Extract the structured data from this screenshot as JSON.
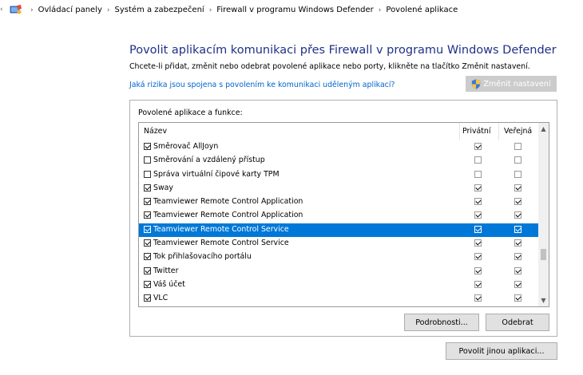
{
  "breadcrumb": {
    "items": [
      "Ovládací panely",
      "Systém a zabezpečení",
      "Firewall v programu Windows Defender",
      "Povolené aplikace"
    ]
  },
  "header": {
    "title": "Povolit aplikacím komunikaci přes Firewall v programu Windows Defender",
    "description": "Chcete-li přidat, změnit nebo odebrat povolené aplikace nebo porty, klikněte na tlačítko Změnit nastavení.",
    "risk_link": "Jaká rizika jsou spojena s povolením ke komunikaci uděleným aplikací?",
    "change_button": "Změnit nastavení"
  },
  "apps": {
    "group_label": "Povolené aplikace a funkce:",
    "columns": {
      "name": "Název",
      "private": "Privátní",
      "public": "Veřejná"
    },
    "rows": [
      {
        "name": "Směrovač AllJoyn",
        "enabled": true,
        "private": true,
        "public": false
      },
      {
        "name": "Směrování a vzdálený přístup",
        "enabled": false,
        "private": false,
        "public": false
      },
      {
        "name": "Správa virtuální čipové karty TPM",
        "enabled": false,
        "private": false,
        "public": false
      },
      {
        "name": "Sway",
        "enabled": true,
        "private": true,
        "public": true
      },
      {
        "name": "Teamviewer Remote Control Application",
        "enabled": true,
        "private": true,
        "public": true
      },
      {
        "name": "Teamviewer Remote Control Application",
        "enabled": true,
        "private": true,
        "public": true
      },
      {
        "name": "Teamviewer Remote Control Service",
        "enabled": true,
        "private": true,
        "public": true,
        "selected": true
      },
      {
        "name": "Teamviewer Remote Control Service",
        "enabled": true,
        "private": true,
        "public": true
      },
      {
        "name": "Tok přihlašovacího portálu",
        "enabled": true,
        "private": true,
        "public": true
      },
      {
        "name": "Twitter",
        "enabled": true,
        "private": true,
        "public": true
      },
      {
        "name": "Váš účet",
        "enabled": true,
        "private": true,
        "public": true
      },
      {
        "name": "VLC",
        "enabled": true,
        "private": true,
        "public": true
      }
    ],
    "details_button": "Podrobnosti...",
    "remove_button": "Odebrat"
  },
  "allow_other_button": "Povolit jinou aplikaci...",
  "colors": {
    "title": "#1e3287",
    "link": "#0066cc",
    "selection": "#0078d7",
    "disabled_button": "#cccccc"
  }
}
